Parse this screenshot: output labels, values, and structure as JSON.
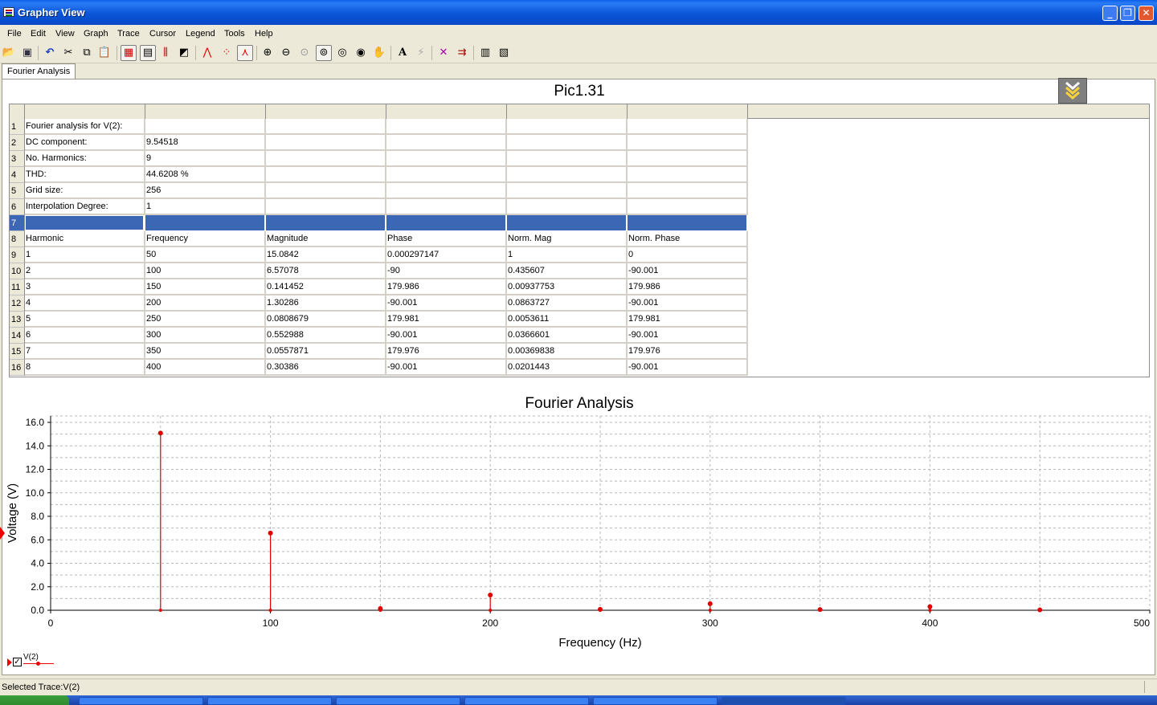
{
  "window": {
    "title": "Grapher View"
  },
  "menu": [
    "File",
    "Edit",
    "View",
    "Graph",
    "Trace",
    "Cursor",
    "Legend",
    "Tools",
    "Help"
  ],
  "tabs": {
    "active": "Fourier Analysis"
  },
  "sheet": {
    "title": "Pic1.31",
    "rows": [
      {
        "n": "1",
        "cells": [
          "Fourier analysis for V(2):",
          "",
          "",
          "",
          "",
          ""
        ]
      },
      {
        "n": "2",
        "cells": [
          "DC component:",
          "9.54518",
          "",
          "",
          "",
          ""
        ]
      },
      {
        "n": "3",
        "cells": [
          "No. Harmonics:",
          "9",
          "",
          "",
          "",
          ""
        ]
      },
      {
        "n": "4",
        "cells": [
          "THD:",
          "44.6208 %",
          "",
          "",
          "",
          ""
        ]
      },
      {
        "n": "5",
        "cells": [
          "Grid size:",
          "256",
          "",
          "",
          "",
          ""
        ]
      },
      {
        "n": "6",
        "cells": [
          "Interpolation Degree:",
          "1",
          "",
          "",
          "",
          ""
        ]
      },
      {
        "n": "7",
        "cells": [
          "",
          "",
          "",
          "",
          "",
          ""
        ],
        "selected": true
      },
      {
        "n": "8",
        "cells": [
          "Harmonic",
          "Frequency",
          "Magnitude",
          "Phase",
          "Norm. Mag",
          "Norm. Phase"
        ]
      },
      {
        "n": "9",
        "cells": [
          "1",
          "50",
          "15.0842",
          "0.000297147",
          "1",
          "0"
        ]
      },
      {
        "n": "10",
        "cells": [
          "2",
          "100",
          "6.57078",
          "-90",
          "0.435607",
          "-90.001"
        ]
      },
      {
        "n": "11",
        "cells": [
          "3",
          "150",
          "0.141452",
          "179.986",
          "0.00937753",
          "179.986"
        ]
      },
      {
        "n": "12",
        "cells": [
          "4",
          "200",
          "1.30286",
          "-90.001",
          "0.0863727",
          "-90.001"
        ]
      },
      {
        "n": "13",
        "cells": [
          "5",
          "250",
          "0.0808679",
          "179.981",
          "0.0053611",
          "179.981"
        ]
      },
      {
        "n": "14",
        "cells": [
          "6",
          "300",
          "0.552988",
          "-90.001",
          "0.0366601",
          "-90.001"
        ]
      },
      {
        "n": "15",
        "cells": [
          "7",
          "350",
          "0.0557871",
          "179.976",
          "0.00369838",
          "179.976"
        ]
      },
      {
        "n": "16",
        "cells": [
          "8",
          "400",
          "0.30386",
          "-90.001",
          "0.0201443",
          "-90.001"
        ]
      }
    ]
  },
  "chart_data": {
    "type": "bar",
    "title": "Fourier Analysis",
    "xlabel": "Frequency (Hz)",
    "ylabel": "Voltage (V)",
    "xlim": [
      0,
      500
    ],
    "ylim": [
      0,
      16
    ],
    "xticks": [
      0,
      100,
      200,
      300,
      400,
      500
    ],
    "xtick_labels": [
      "0",
      "100",
      "200",
      "300",
      "400",
      "500"
    ],
    "yticks": [
      0,
      2,
      4,
      6,
      8,
      10,
      12,
      14,
      16
    ],
    "ytick_labels": [
      "0.0",
      "2.0",
      "4.0",
      "6.0",
      "8.0",
      "10.0",
      "12.0",
      "14.0",
      "16.0"
    ],
    "grid": true,
    "series": [
      {
        "name": "V(2)",
        "color": "#e00000",
        "x": [
          50,
          100,
          150,
          200,
          250,
          300,
          350,
          400,
          450
        ],
        "values": [
          15.0842,
          6.57078,
          0.141452,
          1.30286,
          0.0808679,
          0.552988,
          0.0557871,
          0.30386,
          0.03
        ]
      }
    ],
    "legend_position": "bottom-left"
  },
  "legend": {
    "label": "V(2)",
    "checked": "✓"
  },
  "status": {
    "text": "Selected Trace:V(2)"
  }
}
